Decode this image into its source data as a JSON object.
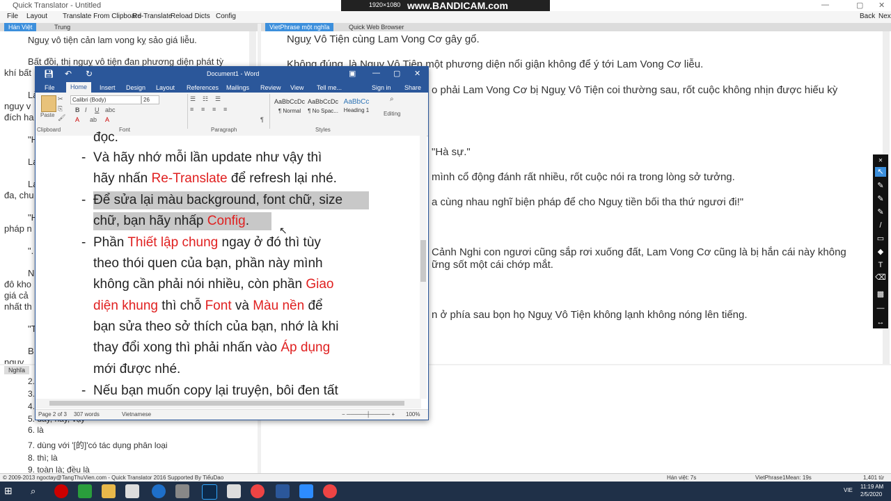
{
  "app": {
    "title": "Quick Translator - Untitled",
    "menu": [
      "File",
      "Layout",
      "Translate From Clipboard",
      "Re-Translate",
      "Reload Dicts",
      "Config"
    ],
    "right_controls": [
      "Back",
      "Next"
    ]
  },
  "recorder": {
    "resolution": "1920×1080",
    "watermark": "www.BANDICAM.com"
  },
  "left_tabs": [
    "Hán Việt",
    "Trung"
  ],
  "right_tabs": [
    "VietPhrase một nghĩa",
    "Quick Web Browser"
  ],
  "han_viet_lines": [
    "Nguỵ vô tiện cản lam vong kỵ sảo giá liễu.",
    "Bất đồi, thị nguỵ vô tiện đan phương diện phát tỳ",
    "khí bất",
    "Là",
    "nguy v",
    "đích ha",
    "\"H",
    "La",
    "La",
    "đa, chu",
    "\"H",
    "pháp n",
    "\".",
    "N",
    "đô kho",
    "giá cả",
    "nhất th",
    "\"T",
    "B",
    "nguy"
  ],
  "vietphrase_lines": [
    "Nguỵ Vô Tiện cùng Lam Vong Cơ gây gổ.",
    "Không đúng, là Nguỵ Vô Tiện một phương diện nổi giận không để ý tới Lam Vong Cơ liễu.",
    "o phải Lam Vong Cơ bị Nguỵ Vô Tiện coi thường sau, rốt cuộc không nhịn được hiếu kỳ",
    "\"Hà sự.\"",
    "mình cổ động đánh rất nhiều, rốt cuộc nói ra trong lòng sở tưởng.",
    "a cùng nhau nghĩ biện pháp để cho Nguỵ tiền bối tha thứ ngươi đi!\"",
    "Cảnh Nghi con ngươi cũng sắp rơi xuống đất, Lam Vong Cơ cũng là bị hắn cái này không",
    "ững sốt một cái chớp mắt.",
    "n ở phía sau bọn họ Nguỵ Vô Tiện không lạnh không nóng lên tiếng."
  ],
  "nghia_label": "Nghĩa",
  "nghia_lines": [
    "2.",
    "3.",
    "4.",
    "5. đây, này, vậy",
    "6. là",
    "7. dùng với '[的]'có tác dụng phân loại",
    "8. thì; là",
    "9. toàn là; đều là"
  ],
  "word": {
    "title": "Document1 - Word",
    "tabs": [
      "File",
      "Home",
      "Insert",
      "Design",
      "Layout",
      "References",
      "Mailings",
      "Review",
      "View",
      "Tell me...",
      "Sign in",
      "Share"
    ],
    "font_name": "Calibri (Body)",
    "font_size": "26",
    "paste_label": "Paste",
    "groups": [
      "Clipboard",
      "Font",
      "Paragraph",
      "Styles",
      "Editing"
    ],
    "styles": [
      {
        "preview": "AaBbCcDc",
        "name": "¶ Normal"
      },
      {
        "preview": "AaBbCcDc",
        "name": "¶ No Spac..."
      },
      {
        "preview": "AaBbCc",
        "name": "Heading 1"
      }
    ],
    "status": {
      "page": "Page 2 of 3",
      "words": "307 words",
      "lang": "Vietnamese",
      "zoom": "100%"
    },
    "doc": {
      "top_partial": "đọc.",
      "b1": [
        "Và hãy nhớ mỗi lần update như vậy thì",
        "hãy nhấn ",
        "Re-Translate",
        " để refresh lại nhé."
      ],
      "b2": [
        "Để sửa lại màu background, font chữ, size",
        "chữ, bạn hãy nhấp ",
        "Config",
        "."
      ],
      "b3": [
        "Phần ",
        "Thiết lập chung",
        " ngay ở đó thì tùy",
        "theo thói quen của bạn, phần này mình",
        "không cần phải nói nhiều, còn phần ",
        "Giao",
        "diện khung",
        " thì chỗ ",
        "Font",
        " và ",
        "Màu nền",
        " để",
        "bạn sửa theo sở thích của bạn, nhớ là khi",
        "thay đổi xong thì phải nhấn vào ",
        "Áp dụng",
        "mới được nhé."
      ],
      "b4": "Nếu bạn muốn copy lại truyện, bôi đen tất"
    }
  },
  "statusbar": {
    "left": "© 2009-2013 ngoctay@TangThuVien.com - Quick Translator 2016 Supported By TiểuDao",
    "hanviet": "Hán việt: 7s",
    "vpmean": "VietPhrase1Mean: 19s",
    "count": "1,401 từ"
  },
  "taskbar": {
    "lang": "VIE",
    "time": "11:19 AM",
    "date": "2/5/2020"
  }
}
